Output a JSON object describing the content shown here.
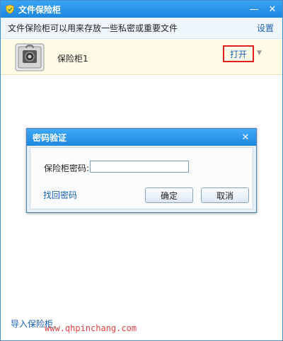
{
  "window": {
    "title": "文件保险柜",
    "description": "文件保险柜可以用来存放一些私密或重要文件",
    "settings_label": "设置",
    "controls": {
      "minimize": "—",
      "close": "✕"
    }
  },
  "vault": {
    "name": "保险柜1",
    "open_label": "打开",
    "dropdown": "▼"
  },
  "footer": {
    "import_label": "导入保险柜",
    "watermark": "www.qhpinchang.com"
  },
  "dialog": {
    "title": "密码验证",
    "password_label": "保险柜密码:",
    "password_value": "",
    "recover_label": "找回密码",
    "ok_label": "确定",
    "cancel_label": "取消",
    "close": "✕"
  },
  "colors": {
    "accent": "#1c86df",
    "link": "#1a5fb4",
    "highlight_border": "#e02020"
  }
}
